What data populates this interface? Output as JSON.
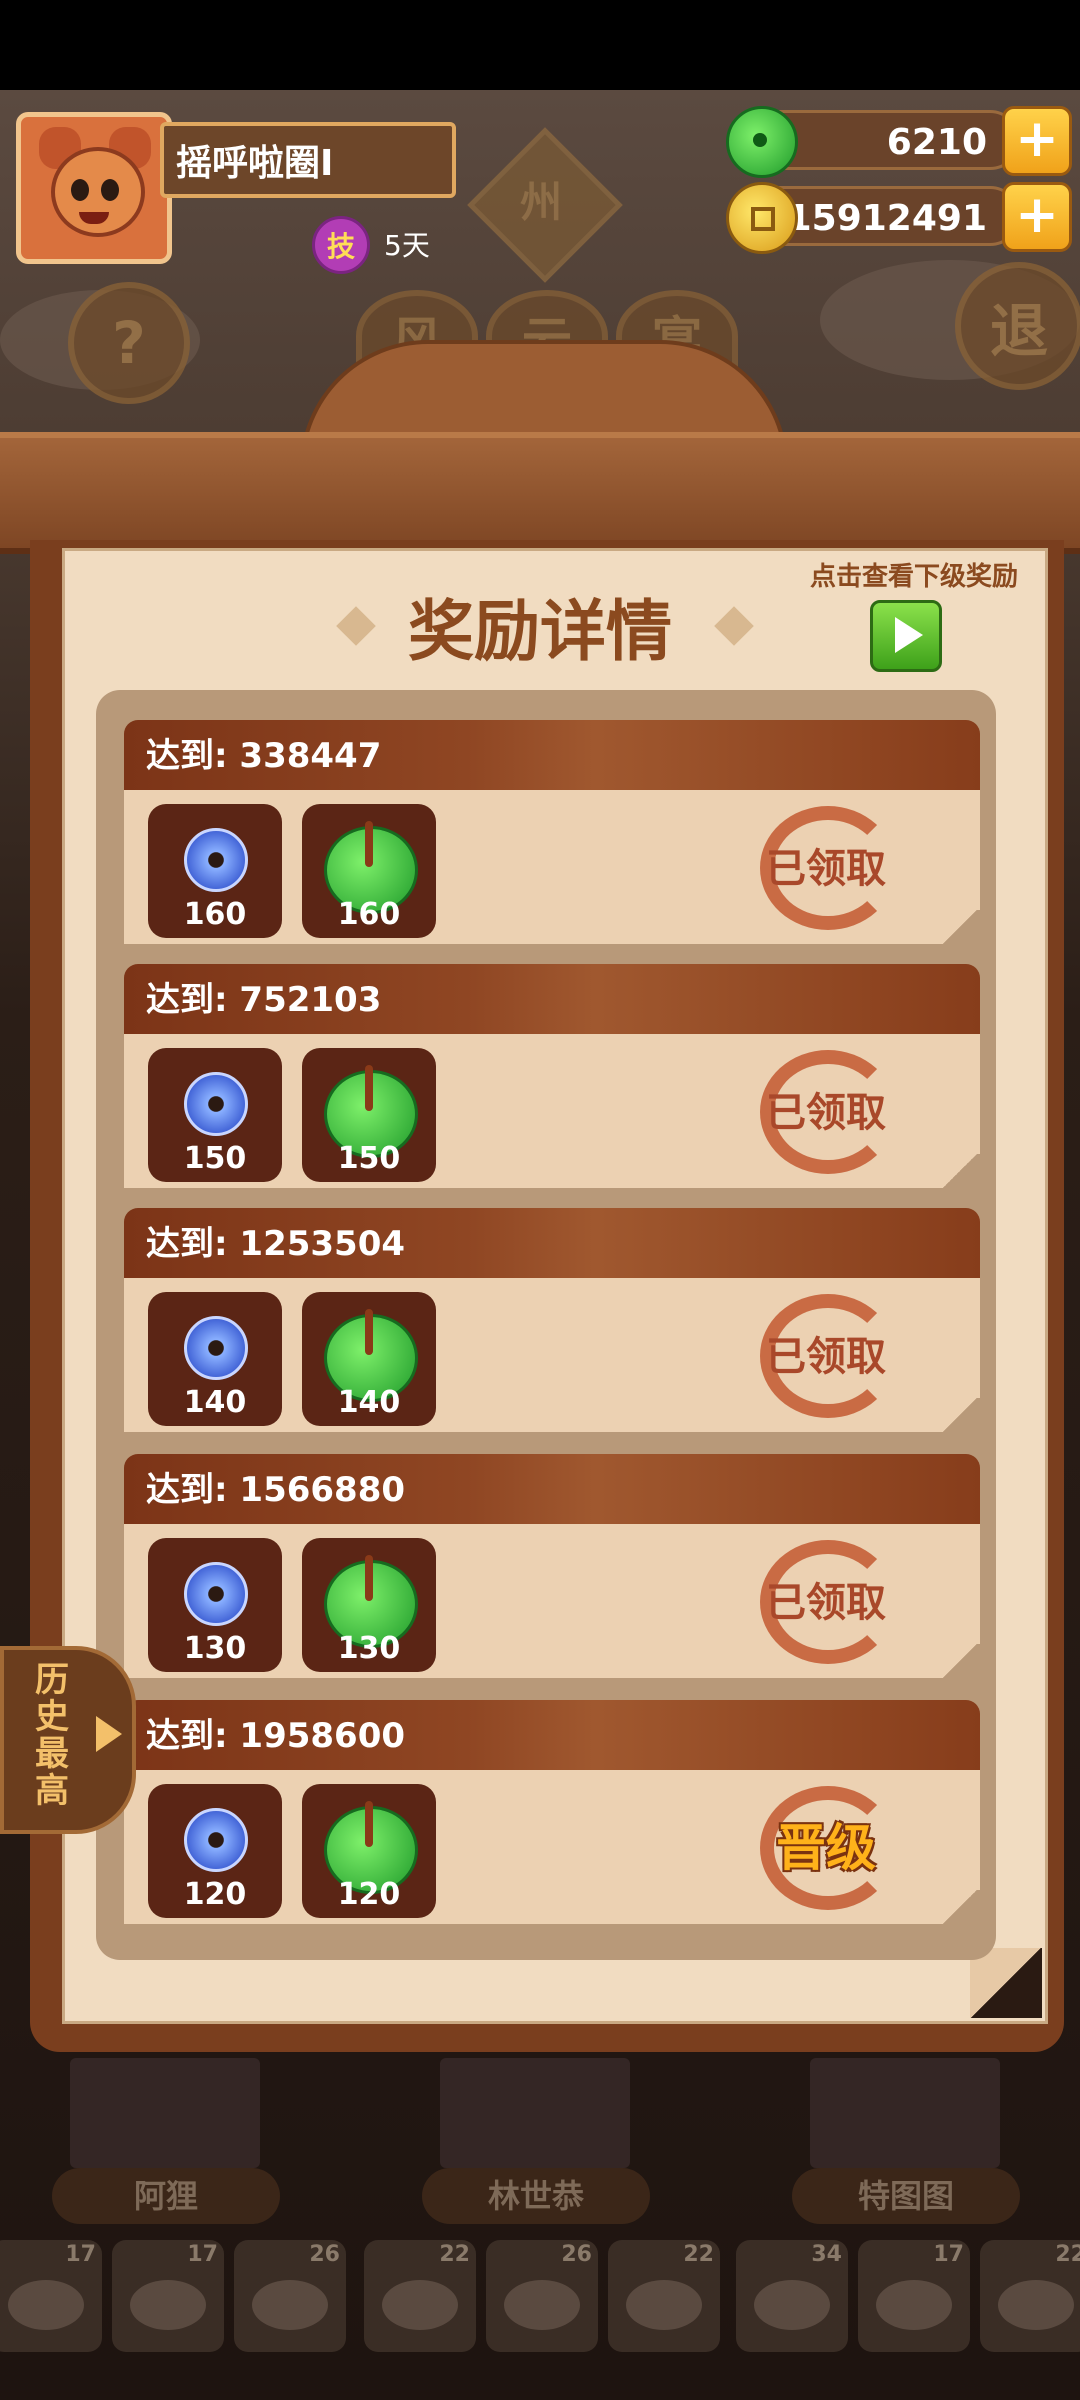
{
  "player": {
    "name": "摇呼啦圈I",
    "skill_badge": "技",
    "skill_days": "5天"
  },
  "resources": {
    "jade": "6210",
    "coins": "15912491"
  },
  "background": {
    "plaque": "州",
    "help_label": "?",
    "exit_label": "退",
    "mid_buttons": [
      "风",
      "云",
      "宴"
    ]
  },
  "panel": {
    "title": "奖励详情",
    "next_tip": "点击查看下级奖励"
  },
  "rewards": [
    {
      "threshold": "达到: 338447",
      "blue": "160",
      "green": "160",
      "status": "已领取"
    },
    {
      "threshold": "达到: 752103",
      "blue": "150",
      "green": "150",
      "status": "已领取"
    },
    {
      "threshold": "达到: 1253504",
      "blue": "140",
      "green": "140",
      "status": "已领取"
    },
    {
      "threshold": "达到: 1566880",
      "blue": "130",
      "green": "130",
      "status": "已领取"
    },
    {
      "threshold": "达到: 1958600",
      "blue": "120",
      "green": "120",
      "status": "晋级"
    }
  ],
  "history_tab": "历史最高",
  "characters": [
    "阿狸",
    "林世恭",
    "特图图"
  ],
  "food_counts": [
    "17",
    "17",
    "26",
    "22",
    "26",
    "22",
    "34",
    "17",
    "22"
  ]
}
